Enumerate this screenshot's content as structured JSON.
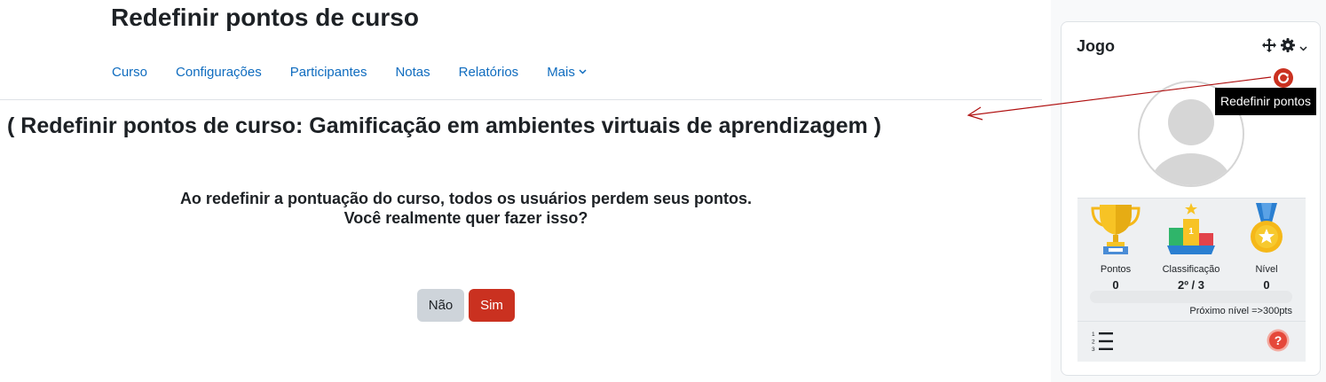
{
  "header": {
    "title": "Redefinir pontos de curso"
  },
  "nav": {
    "items": [
      "Curso",
      "Configurações",
      "Participantes",
      "Notas",
      "Relatórios",
      "Mais"
    ]
  },
  "main": {
    "heading": "( Redefinir pontos de curso: Gamificação em ambientes virtuais de aprendizagem )",
    "message_line1": "Ao redefinir a pontuação do curso, todos os usuários perdem seus pontos.",
    "message_line2": "Você realmente quer fazer isso?",
    "no_button": "Não",
    "yes_button": "Sim"
  },
  "block": {
    "title": "Jogo",
    "tooltip": "Redefinir pontos",
    "stats": [
      {
        "label": "Pontos",
        "value": "0",
        "icon": "trophy-icon"
      },
      {
        "label": "Classificação",
        "value": "2º / 3",
        "icon": "podium-icon"
      },
      {
        "label": "Nível",
        "value": "0",
        "icon": "medal-icon"
      }
    ],
    "progress_fraction": 0,
    "next_level": "Próximo nível =>300pts"
  },
  "colors": {
    "link": "#0f6cbf",
    "danger": "#ca3120",
    "secondary_button": "#ced4da",
    "arrow": "#b01010"
  }
}
